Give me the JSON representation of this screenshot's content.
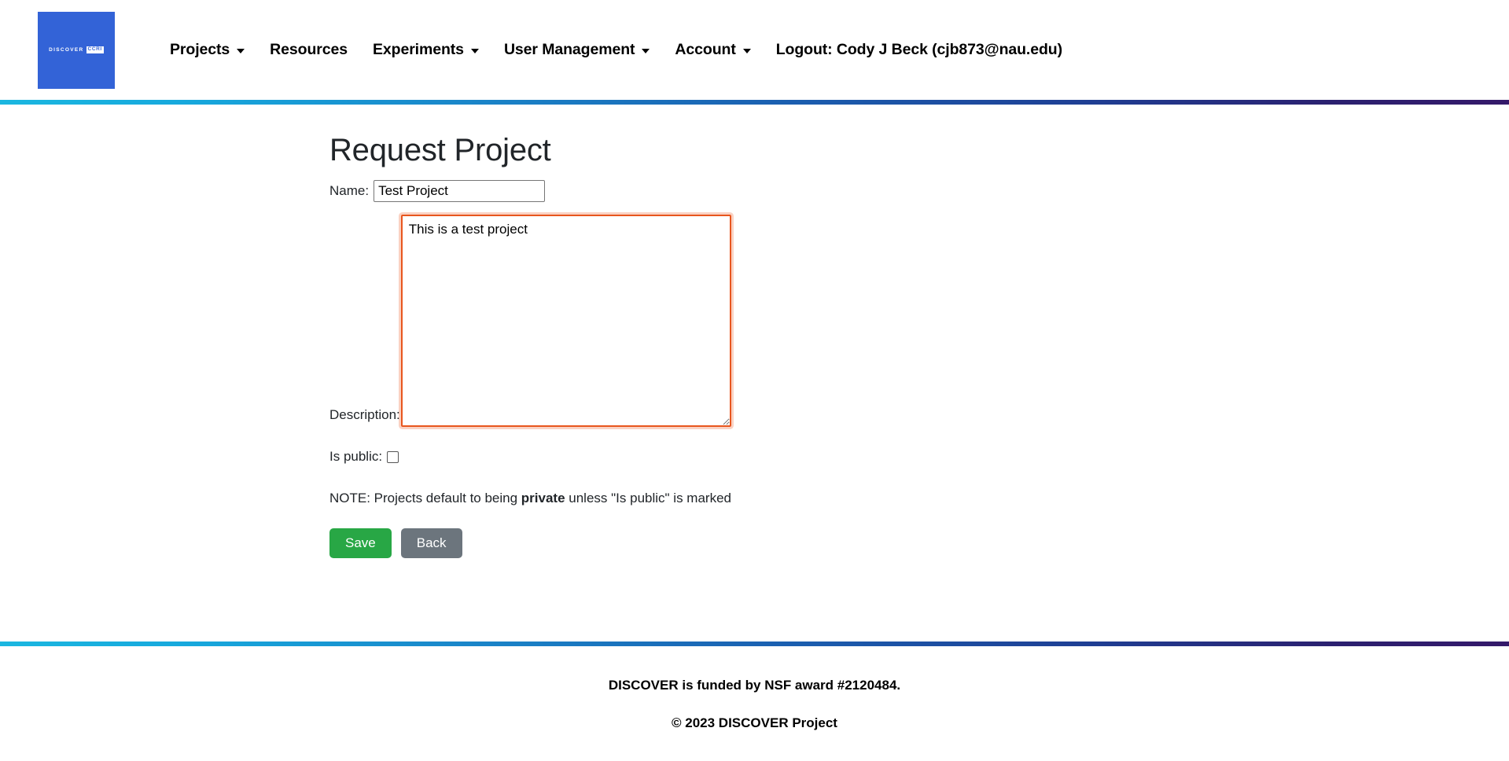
{
  "brand": {
    "word": "DISCOVER",
    "tag": "CCRI",
    "bg_color": "#3363d7"
  },
  "nav": {
    "items": [
      {
        "label": "Projects",
        "has_caret": true
      },
      {
        "label": "Resources",
        "has_caret": false
      },
      {
        "label": "Experiments",
        "has_caret": true
      },
      {
        "label": "User Management",
        "has_caret": true
      },
      {
        "label": "Account",
        "has_caret": true
      },
      {
        "label": "Logout: Cody J Beck (cjb873@nau.edu)",
        "has_caret": false
      }
    ]
  },
  "form": {
    "title": "Request Project",
    "name_label": "Name:",
    "name_value": "Test Project",
    "name_placeholder": "",
    "description_label": "Description:",
    "description_value": "This is a test project",
    "description_placeholder": "",
    "is_public_label": "Is public:",
    "is_public_checked": false,
    "note_prefix": "NOTE: Projects default to being ",
    "note_emphasis": "private",
    "note_suffix": " unless \"Is public\" is marked",
    "save_label": "Save",
    "back_label": "Back",
    "focus_color": "#e8561e"
  },
  "footer": {
    "funding": "DISCOVER is funded by NSF award #2120484.",
    "copyright": "© 2023 DISCOVER Project",
    "gradient_start": "#1bb7e0",
    "gradient_end": "#35196a"
  }
}
